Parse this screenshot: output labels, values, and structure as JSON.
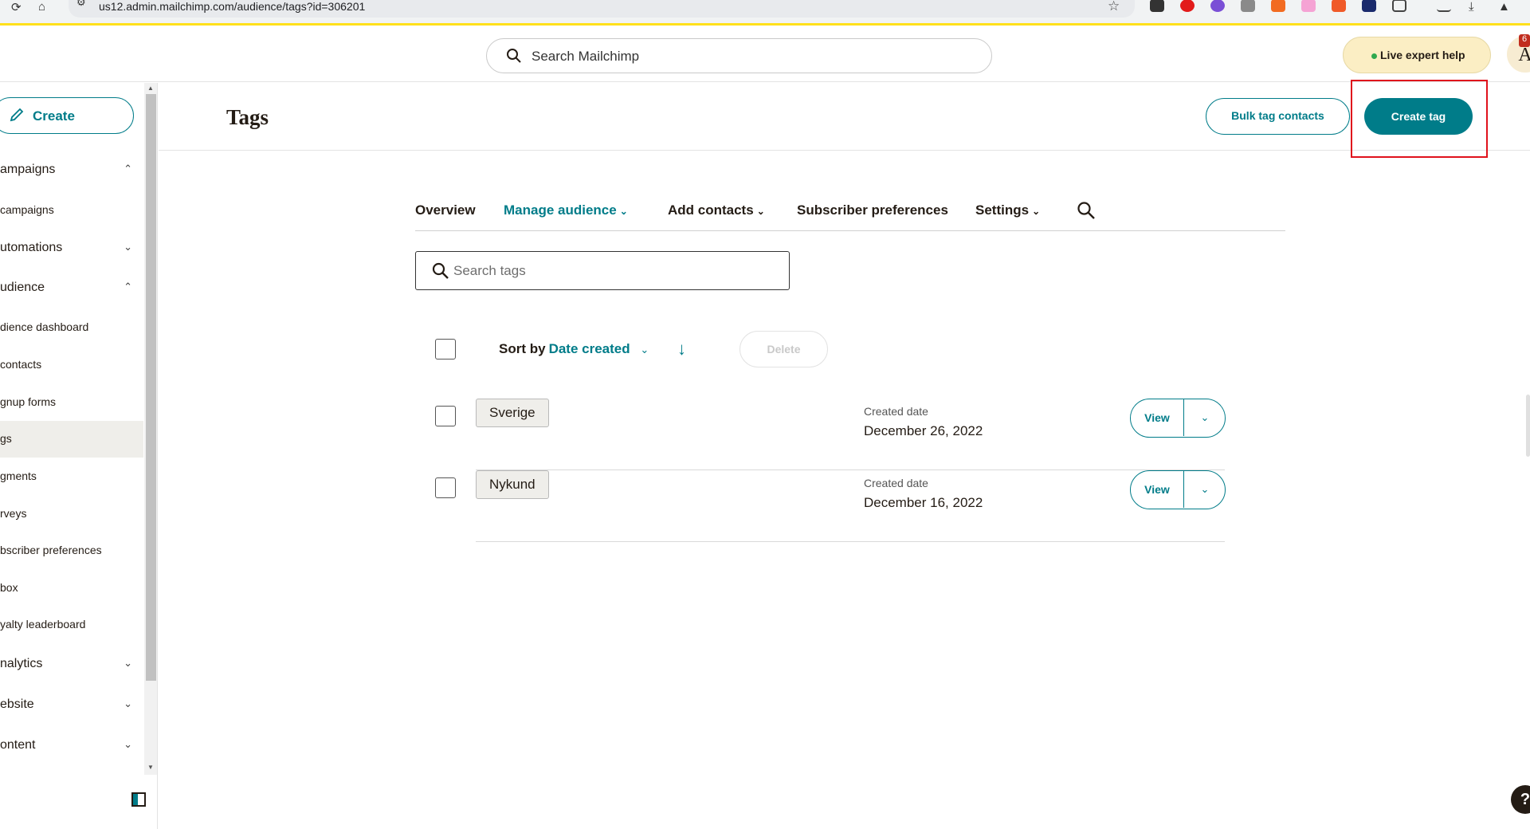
{
  "browser": {
    "url": "us12.admin.mailchimp.com/audience/tags?id=306201"
  },
  "topbar": {
    "search_placeholder": "Search Mailchimp",
    "live_help": "Live expert help",
    "avatar_letter": "A",
    "notification_count": "6"
  },
  "sidebar": {
    "create_label": "Create",
    "items": [
      {
        "label": "ampaigns",
        "chevron": "⌃"
      },
      {
        "label": "campaigns"
      },
      {
        "label": "utomations",
        "chevron": "⌄"
      },
      {
        "label": "udience",
        "chevron": "⌃"
      },
      {
        "label": "dience dashboard"
      },
      {
        "label": "contacts"
      },
      {
        "label": "gnup forms"
      },
      {
        "label": "gs"
      },
      {
        "label": "gments"
      },
      {
        "label": "rveys"
      },
      {
        "label": "bscriber preferences"
      },
      {
        "label": "box"
      },
      {
        "label": "yalty leaderboard"
      },
      {
        "label": "nalytics",
        "chevron": "⌄"
      },
      {
        "label": "ebsite",
        "chevron": "⌄"
      },
      {
        "label": "ontent",
        "chevron": "⌄"
      }
    ]
  },
  "header": {
    "title": "Tags",
    "bulk_label": "Bulk tag contacts",
    "create_tag_label": "Create tag"
  },
  "tabs": [
    {
      "label": "Overview"
    },
    {
      "label": "Manage audience"
    },
    {
      "label": "Add contacts"
    },
    {
      "label": "Subscriber preferences"
    },
    {
      "label": "Settings"
    }
  ],
  "search_tags": {
    "placeholder": "Search tags"
  },
  "sort": {
    "prefix": "Sort by",
    "value": "Date created",
    "delete_label": "Delete"
  },
  "rows": [
    {
      "tag": "Sverige",
      "date_label": "Created date",
      "date": "December 26, 2022",
      "view": "View"
    },
    {
      "tag": "Nykund",
      "date_label": "Created date",
      "date": "December 16, 2022",
      "view": "View"
    }
  ],
  "help": {
    "label": "?"
  },
  "colors": {
    "accent": "#007c89",
    "highlight": "#e0121c",
    "brand_yellow": "#ffe01b"
  }
}
